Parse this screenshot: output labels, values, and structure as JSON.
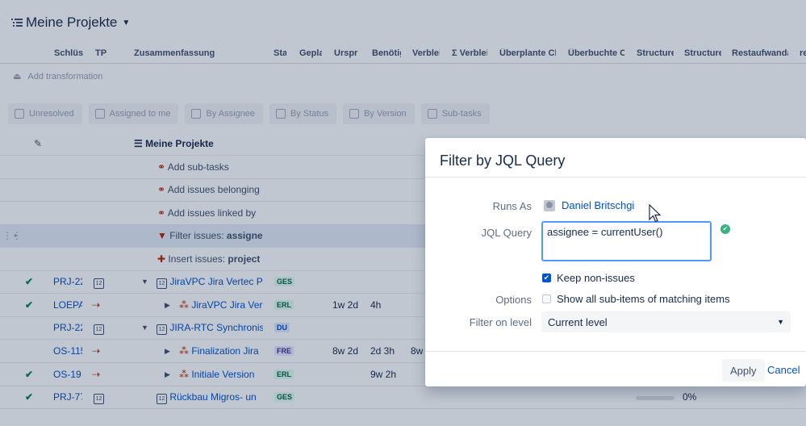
{
  "page": {
    "title": "Meine Projekte"
  },
  "columns": [
    "Schlüss",
    "TP",
    "Zusammenfassung",
    "Sta",
    "Gepla",
    "Urspri",
    "Benötig",
    "Verblei",
    "Σ Verblei",
    "Überplante Ch",
    "Überbuchte Cl",
    "Structure",
    "Structure",
    "Restaufwanda",
    "re"
  ],
  "toolbar": {
    "add_transformation": "Add transformation"
  },
  "chips": [
    "Unresolved",
    "Assigned to me",
    "By Assignee",
    "By Status",
    "By Version",
    "Sub-tasks"
  ],
  "tree": {
    "root": "Meine Projekte",
    "generators": [
      {
        "text": "Add sub-tasks"
      },
      {
        "text": "Add issues belonging"
      },
      {
        "text": "Add issues linked by"
      },
      {
        "text": "Filter issues: ",
        "bold": "assigne"
      },
      {
        "text": "Insert issues: ",
        "bold": "project"
      }
    ]
  },
  "rows": [
    {
      "done": "✔",
      "key": "PRJ-22",
      "tp": "12",
      "summary": "JiraVPC Jira Vertec Ph",
      "status": "GES",
      "plan": "",
      "orig": "",
      "need": "",
      "rem": ""
    },
    {
      "done": "✔",
      "key": "LOEPA",
      "tp": "⇢",
      "summary": "JiraVPC Jira Vert",
      "status": "ERL",
      "plan": "",
      "orig": "1w 2d",
      "need": "4h",
      "rem": ""
    },
    {
      "done": "",
      "key": "PRJ-22",
      "tp": "12",
      "summary": "JIRA-RTC Synchronis",
      "status": "DU",
      "plan": "",
      "orig": "",
      "need": "",
      "rem": ""
    },
    {
      "done": "",
      "key": "OS-115",
      "tp": "⇢",
      "summary": "Finalization Jira",
      "status": "FRE",
      "plan": "",
      "orig": "8w 2d",
      "need": "2d 3h",
      "rem": "8w"
    },
    {
      "done": "✔",
      "key": "OS-19",
      "tp": "⇢",
      "summary": "Initiale Version",
      "status": "ERL",
      "plan": "",
      "orig": "",
      "need": "9w 2h",
      "rem": ""
    },
    {
      "done": "✔",
      "key": "PRJ-77",
      "tp": "12",
      "summary": "Rückbau Migros- un",
      "status": "GES",
      "plan": "",
      "orig": "",
      "need": "",
      "rem": "",
      "progress": "0%"
    }
  ],
  "dialog": {
    "title": "Filter by JQL Query",
    "runs_as_label": "Runs As",
    "runs_as_user": "Daniel Britschgi",
    "jql_label": "JQL Query",
    "jql_value": "assignee = currentUser()",
    "keep_non_issues": "Keep non-issues",
    "options_label": "Options",
    "show_all": "Show all sub-items of matching items",
    "filter_level_label": "Filter on level",
    "filter_level_value": "Current level",
    "apply": "Apply",
    "cancel": "Cancel"
  },
  "colors": {
    "accent": "#0052cc",
    "success": "#36b37e",
    "overlay": "#091e42"
  }
}
